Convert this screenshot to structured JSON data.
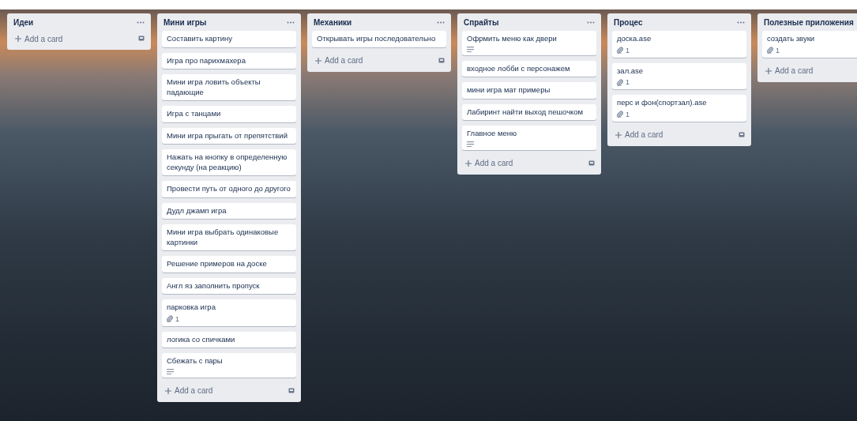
{
  "lists": [
    {
      "title": "Идеи",
      "menu": true,
      "template_button": true,
      "add_label": "Add a card"
    },
    {
      "title": "Мини игры",
      "menu": true,
      "template_button": true,
      "add_label": "Add a card",
      "cards": [
        {
          "title": "Составить картину"
        },
        {
          "title": "Игра про парихмахера"
        },
        {
          "title": "Мини игра ловить объекты падающие"
        },
        {
          "title": "Игра с танцами"
        },
        {
          "title": "Мини игра прыгать от препятствий"
        },
        {
          "title": "Нажать на кнопку в определенную секунду (на реакцию)"
        },
        {
          "title": "Провести путь от одного до другого"
        },
        {
          "title": "Дудл джамп игра"
        },
        {
          "title": "Мини игра выбрать одинаковые картинки"
        },
        {
          "title": "Решение примеров на доске"
        },
        {
          "title": "Англ яз заполнить пропуск"
        },
        {
          "title": "парковка игра",
          "badges": [
            {
              "kind": "attachments",
              "count": "1"
            }
          ]
        },
        {
          "title": "логика со спичками"
        },
        {
          "title": "Сбежать с пары",
          "badges": [
            {
              "kind": "description"
            }
          ]
        }
      ]
    },
    {
      "title": "Механики",
      "menu": true,
      "template_button": true,
      "add_label": "Add a card",
      "cards": [
        {
          "title": "Открывать игры последовательно"
        }
      ]
    },
    {
      "title": "Спрайты",
      "menu": true,
      "template_button": true,
      "add_label": "Add a card",
      "cards": [
        {
          "title": "Офрмить меню как двери",
          "badges": [
            {
              "kind": "description"
            }
          ]
        },
        {
          "title": "входное лобби с персонажем"
        },
        {
          "title": "мини игра мат примеры"
        },
        {
          "title": "Лабиринт найти выход пешочком"
        },
        {
          "title": "Главное меню",
          "badges": [
            {
              "kind": "description"
            }
          ]
        }
      ]
    },
    {
      "title": "Процес",
      "menu": true,
      "template_button": true,
      "add_label": "Add a card",
      "cards": [
        {
          "title": "доска.ase",
          "badges": [
            {
              "kind": "attachments",
              "count": "1"
            }
          ]
        },
        {
          "title": "зал.ase",
          "badges": [
            {
              "kind": "attachments",
              "count": "1"
            }
          ]
        },
        {
          "title": "перс и фон(спортзал).ase",
          "badges": [
            {
              "kind": "attachments",
              "count": "1"
            }
          ]
        }
      ]
    },
    {
      "title": "Полезные приложения",
      "menu": false,
      "template_button": false,
      "add_label": "Add a card",
      "cards": [
        {
          "title": "создать звуки",
          "badges": [
            {
              "kind": "attachments",
              "count": "1"
            }
          ]
        }
      ]
    }
  ]
}
